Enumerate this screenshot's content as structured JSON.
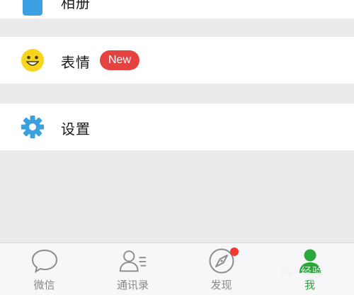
{
  "menu": {
    "top_partial": {
      "label": "相册",
      "icon": "photo-album-icon"
    },
    "emoji": {
      "label": "表情",
      "badge": "New",
      "icon": "smiley-face-icon"
    },
    "settings": {
      "label": "设置",
      "icon": "gear-icon"
    }
  },
  "tabbar": {
    "tabs": [
      {
        "label": "微信",
        "icon": "chat-bubble-icon"
      },
      {
        "label": "通讯录",
        "icon": "contacts-icon"
      },
      {
        "label": "发现",
        "icon": "compass-icon"
      },
      {
        "label": "我",
        "icon": "person-icon"
      }
    ],
    "active_index": 3
  },
  "watermark": {
    "text": "Bai 经验"
  },
  "colors": {
    "accent_green": "#2aaa3b",
    "badge_red": "#e64340",
    "icon_blue": "#3aa0e0",
    "emoji_yellow": "#f7d51d",
    "background": "#ebebeb"
  }
}
